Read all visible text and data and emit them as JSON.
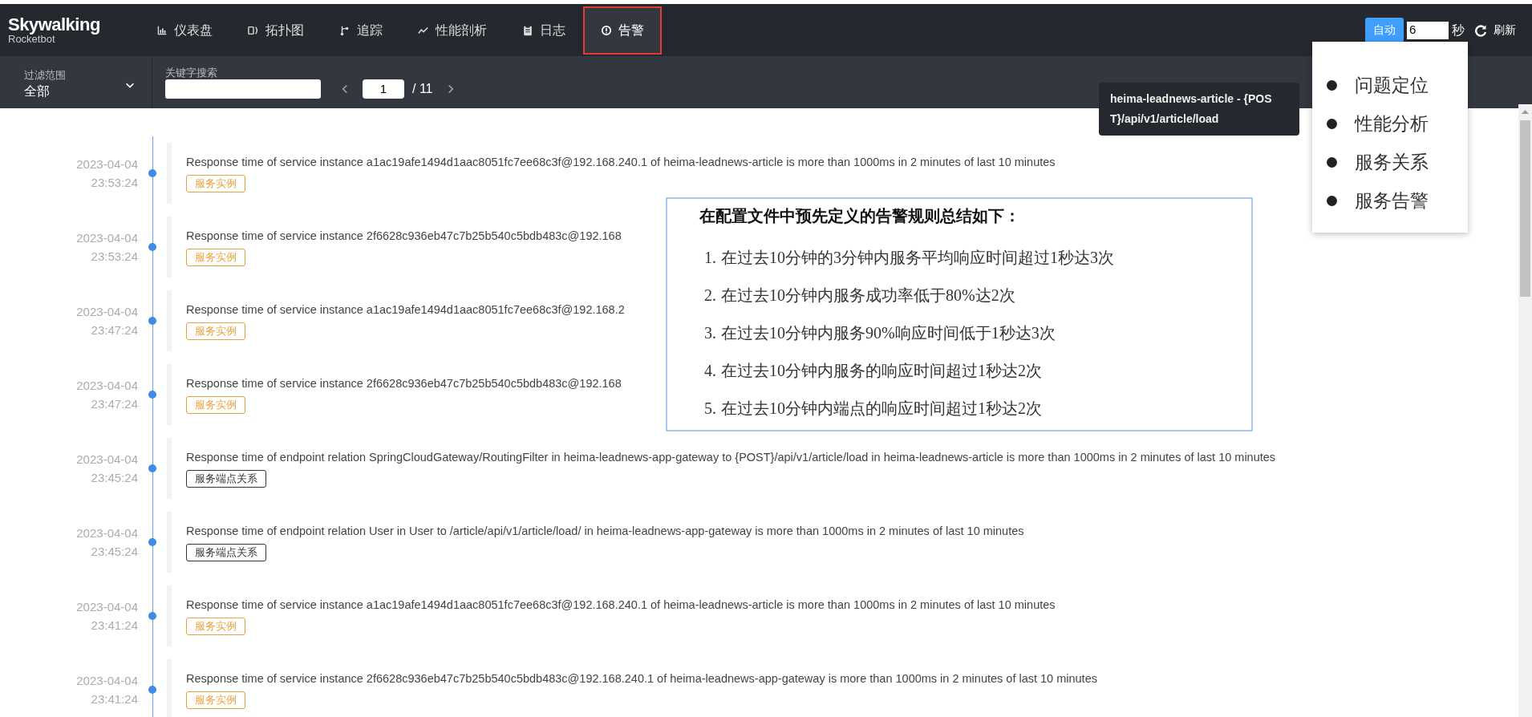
{
  "header": {
    "logo": "Skywalking",
    "subtitle": "Rocketbot",
    "nav": [
      {
        "label": "仪表盘",
        "selected": false,
        "highlighted": false
      },
      {
        "label": "拓扑图",
        "selected": false,
        "highlighted": false
      },
      {
        "label": "追踪",
        "selected": false,
        "highlighted": false
      },
      {
        "label": "性能剖析",
        "selected": false,
        "highlighted": false
      },
      {
        "label": "日志",
        "selected": false,
        "highlighted": false
      },
      {
        "label": "告警",
        "selected": true,
        "highlighted": true
      }
    ],
    "auto_button": "自动",
    "interval": "6",
    "interval_unit": "秒",
    "refresh": "刷新"
  },
  "filter": {
    "scope_label": "过滤范围",
    "scope_value": "全部",
    "keyword_label": "关键字搜索",
    "page": "1",
    "total": "/ 11"
  },
  "alarms": [
    {
      "date": "2023-04-04",
      "time": "23:53:24",
      "message": "Response time of service instance a1ac19afe1494d1aac8051fc7ee68c3f@192.168.240.1 of heima-leadnews-article is more than 1000ms in 2 minutes of last 10 minutes",
      "tag": "服务实例",
      "kind": "instance"
    },
    {
      "date": "2023-04-04",
      "time": "23:53:24",
      "message": "Response time of service instance 2f6628c936eb47c7b25b540c5bdb483c@192.168",
      "tag": "服务实例",
      "kind": "instance"
    },
    {
      "date": "2023-04-04",
      "time": "23:47:24",
      "message": "Response time of service instance a1ac19afe1494d1aac8051fc7ee68c3f@192.168.2",
      "tag": "服务实例",
      "kind": "instance"
    },
    {
      "date": "2023-04-04",
      "time": "23:47:24",
      "message": "Response time of service instance 2f6628c936eb47c7b25b540c5bdb483c@192.168",
      "tag": "服务实例",
      "kind": "instance"
    },
    {
      "date": "2023-04-04",
      "time": "23:45:24",
      "message": "Response time of endpoint relation SpringCloudGateway/RoutingFilter in heima-leadnews-app-gateway to {POST}/api/v1/article/load in heima-leadnews-article is more than 1000ms in 2 minutes of last 10 minutes",
      "tag": "服务端点关系",
      "kind": "endpoint_relation"
    },
    {
      "date": "2023-04-04",
      "time": "23:45:24",
      "message": "Response time of endpoint relation User in User to /article/api/v1/article/load/ in heima-leadnews-app-gateway is more than 1000ms in 2 minutes of last 10 minutes",
      "tag": "服务端点关系",
      "kind": "endpoint_relation"
    },
    {
      "date": "2023-04-04",
      "time": "23:41:24",
      "message": "Response time of service instance a1ac19afe1494d1aac8051fc7ee68c3f@192.168.240.1 of heima-leadnews-article is more than 1000ms in 2 minutes of last 10 minutes",
      "tag": "服务实例",
      "kind": "instance"
    },
    {
      "date": "2023-04-04",
      "time": "23:41:24",
      "message": "Response time of service instance 2f6628c936eb47c7b25b540c5bdb483c@192.168.240.1 of heima-leadnews-app-gateway is more than 1000ms in 2 minutes of last 10 minutes",
      "tag": "服务实例",
      "kind": "instance"
    }
  ],
  "tooltip": {
    "lines": [
      "heima-leadnews-article - {POS",
      "T}/api/v1/article/load"
    ]
  },
  "note": {
    "title": "在配置文件中预先定义的告警规则总结如下：",
    "items": [
      {
        "number": "1.",
        "text": "在过去10分钟的3分钟内服务平均响应时间超过1秒达3次"
      },
      {
        "number": "2.",
        "text": "在过去10分钟内服务成功率低于80%达2次"
      },
      {
        "number": "3.",
        "text": "在过去10分钟内服务90%响应时间低于1秒达3次"
      },
      {
        "number": "4.",
        "text": "在过去10分钟内服务的响应时间超过1秒达2次"
      },
      {
        "number": "5.",
        "text": "在过去10分钟内端点的响应时间超过1秒达2次"
      }
    ]
  },
  "menu": {
    "items": [
      "问题定位",
      "性能分析",
      "服务关系",
      "服务告警"
    ]
  }
}
